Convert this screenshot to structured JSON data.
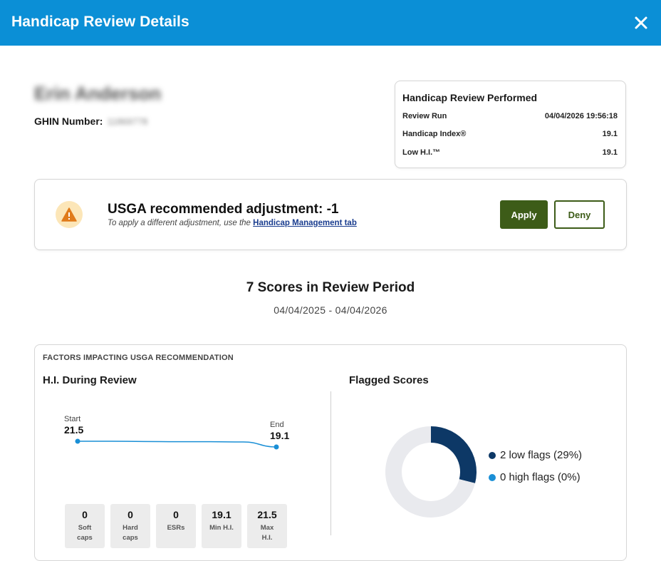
{
  "header": {
    "title": "Handicap Review Details",
    "close_icon": "close-icon"
  },
  "golfer": {
    "name": "Erin Anderson",
    "ghin_label": "GHIN Number:",
    "ghin_value": "11869778"
  },
  "review_card": {
    "title": "Handicap Review Performed",
    "rows": [
      {
        "label": "Review Run",
        "value": "04/04/2026 19:56:18"
      },
      {
        "label": "Handicap Index®",
        "value": "19.1"
      },
      {
        "label": "Low H.I.™",
        "value": "19.1"
      }
    ]
  },
  "adjustment": {
    "icon": "warning-icon",
    "title": "USGA recommended adjustment: -1",
    "subtitle_prefix": "To apply a different adjustment, use the ",
    "link_text": "Handicap Management tab",
    "apply_label": "Apply",
    "deny_label": "Deny",
    "colors": {
      "warn_bg": "#fce6b8",
      "warn_icon": "#e07b1a",
      "primary": "#3d5c18"
    }
  },
  "scores": {
    "heading": "7 Scores in Review Period",
    "range": "04/04/2025 - 04/04/2026"
  },
  "factors": {
    "title": "FACTORS IMPACTING USGA RECOMMENDATION",
    "hi_title": "H.I. During Review",
    "flag_title": "Flagged Scores",
    "start_label": "Start",
    "start_value": "21.5",
    "end_label": "End",
    "end_value": "19.1",
    "stats": [
      {
        "value": "0",
        "label1": "Soft",
        "label2": "caps"
      },
      {
        "value": "0",
        "label1": "Hard",
        "label2": "caps"
      },
      {
        "value": "0",
        "label1": "ESRs",
        "label2": ""
      },
      {
        "value": "19.1",
        "label1": "Min H.I.",
        "label2": ""
      },
      {
        "value": "21.5",
        "label1": "Max",
        "label2": "H.I."
      }
    ],
    "legend": [
      {
        "text": "2 low flags (29%)",
        "color": "#0d3866"
      },
      {
        "text": "0 high flags (0%)",
        "color": "#1a8fd6"
      }
    ]
  },
  "chart_data": [
    {
      "type": "line",
      "title": "H.I. During Review",
      "series": [
        {
          "values": [
            21.5,
            21.5,
            21.4,
            21.3,
            21.3,
            21.2,
            19.1
          ]
        }
      ],
      "colors": {
        "line": "#1a8fd6"
      }
    },
    {
      "type": "pie",
      "title": "Flagged Scores",
      "slices": [
        {
          "label": "2 low flags (29%)",
          "value": 29,
          "color": "#0d3866"
        },
        {
          "label": "0 high flags (0%)",
          "value": 0,
          "color": "#1a8fd6"
        },
        {
          "label": "",
          "value": 71,
          "color": "#e9eaee"
        }
      ]
    }
  ]
}
